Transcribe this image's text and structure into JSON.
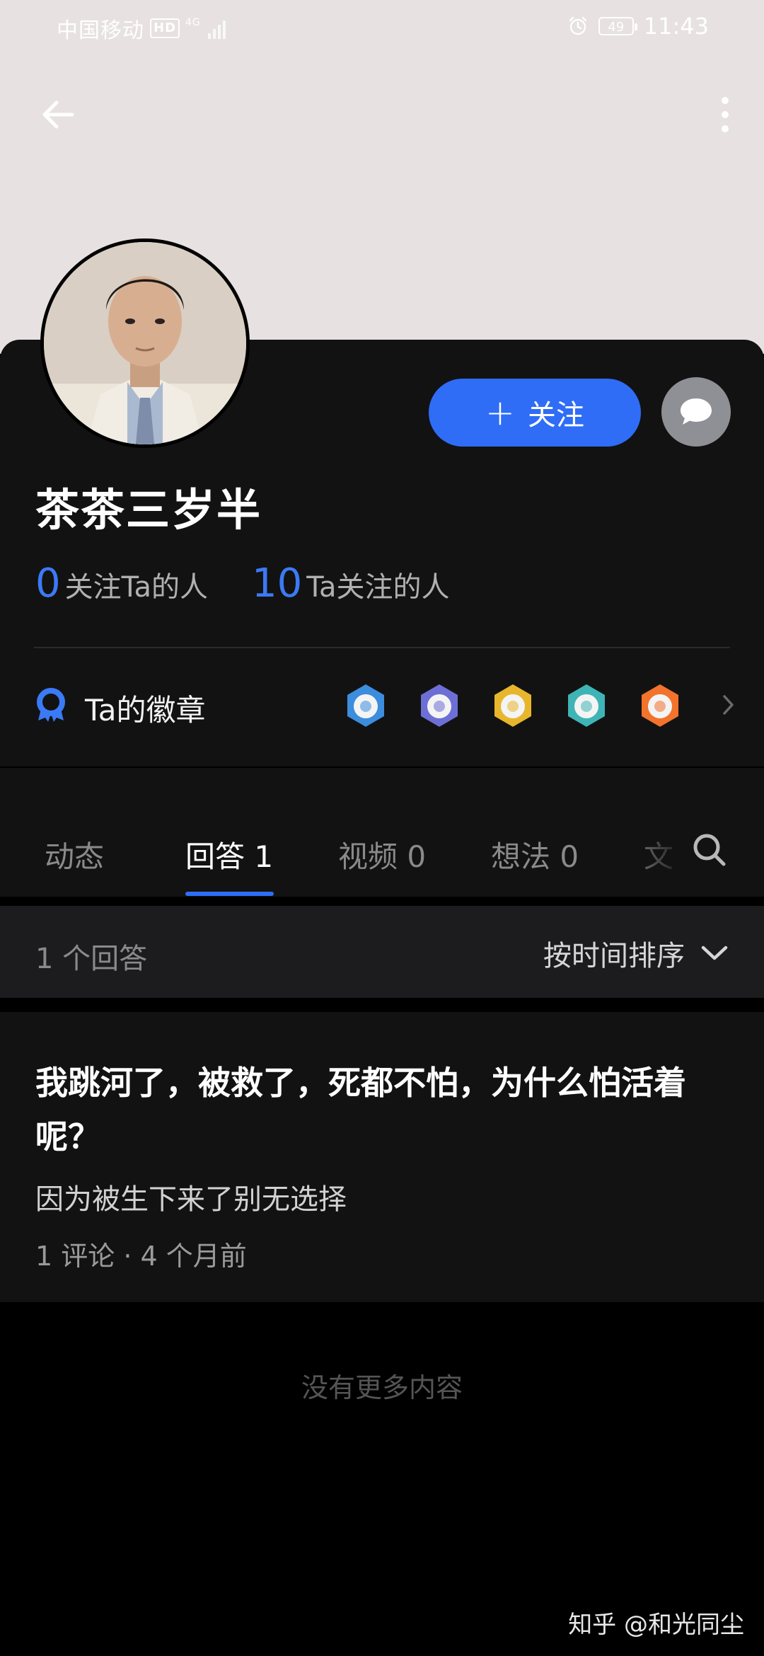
{
  "status_bar": {
    "carrier": "中国移动",
    "hd": "HD",
    "network": "4G",
    "battery": "49",
    "time": "11:43"
  },
  "profile": {
    "name": "茶茶三岁半",
    "follow_label": "关注",
    "followers_count": "0",
    "followers_label": "关注Ta的人",
    "following_count": "10",
    "following_label": "Ta关注的人",
    "badges_title": "Ta的徽章"
  },
  "badges": [
    {
      "icon": "badge-blue-icon",
      "color": "#3c8dde"
    },
    {
      "icon": "badge-purple-icon",
      "color": "#6d6fd6"
    },
    {
      "icon": "badge-gold-icon",
      "color": "#e8b62c"
    },
    {
      "icon": "badge-teal-icon",
      "color": "#3fb4b6"
    },
    {
      "icon": "badge-orange-icon",
      "color": "#f2732c"
    }
  ],
  "tabs": [
    {
      "label": "动态",
      "active": false
    },
    {
      "label": "回答 1",
      "active": true
    },
    {
      "label": "视频 0",
      "active": false
    },
    {
      "label": "想法 0",
      "active": false
    },
    {
      "label": "文",
      "active": false
    }
  ],
  "list": {
    "count_label": "1 个回答",
    "sort_label": "按时间排序"
  },
  "answer": {
    "question": "我跳河了，被救了，死都不怕，为什么怕活着呢？",
    "excerpt": "因为被生下来了别无选择",
    "meta": "1 评论 · 4 个月前"
  },
  "footer": {
    "no_more": "没有更多内容"
  },
  "watermark": "知乎 @和光同尘",
  "colors": {
    "accent": "#2f6df6",
    "card": "#121212",
    "header": "#e7e1e1"
  }
}
